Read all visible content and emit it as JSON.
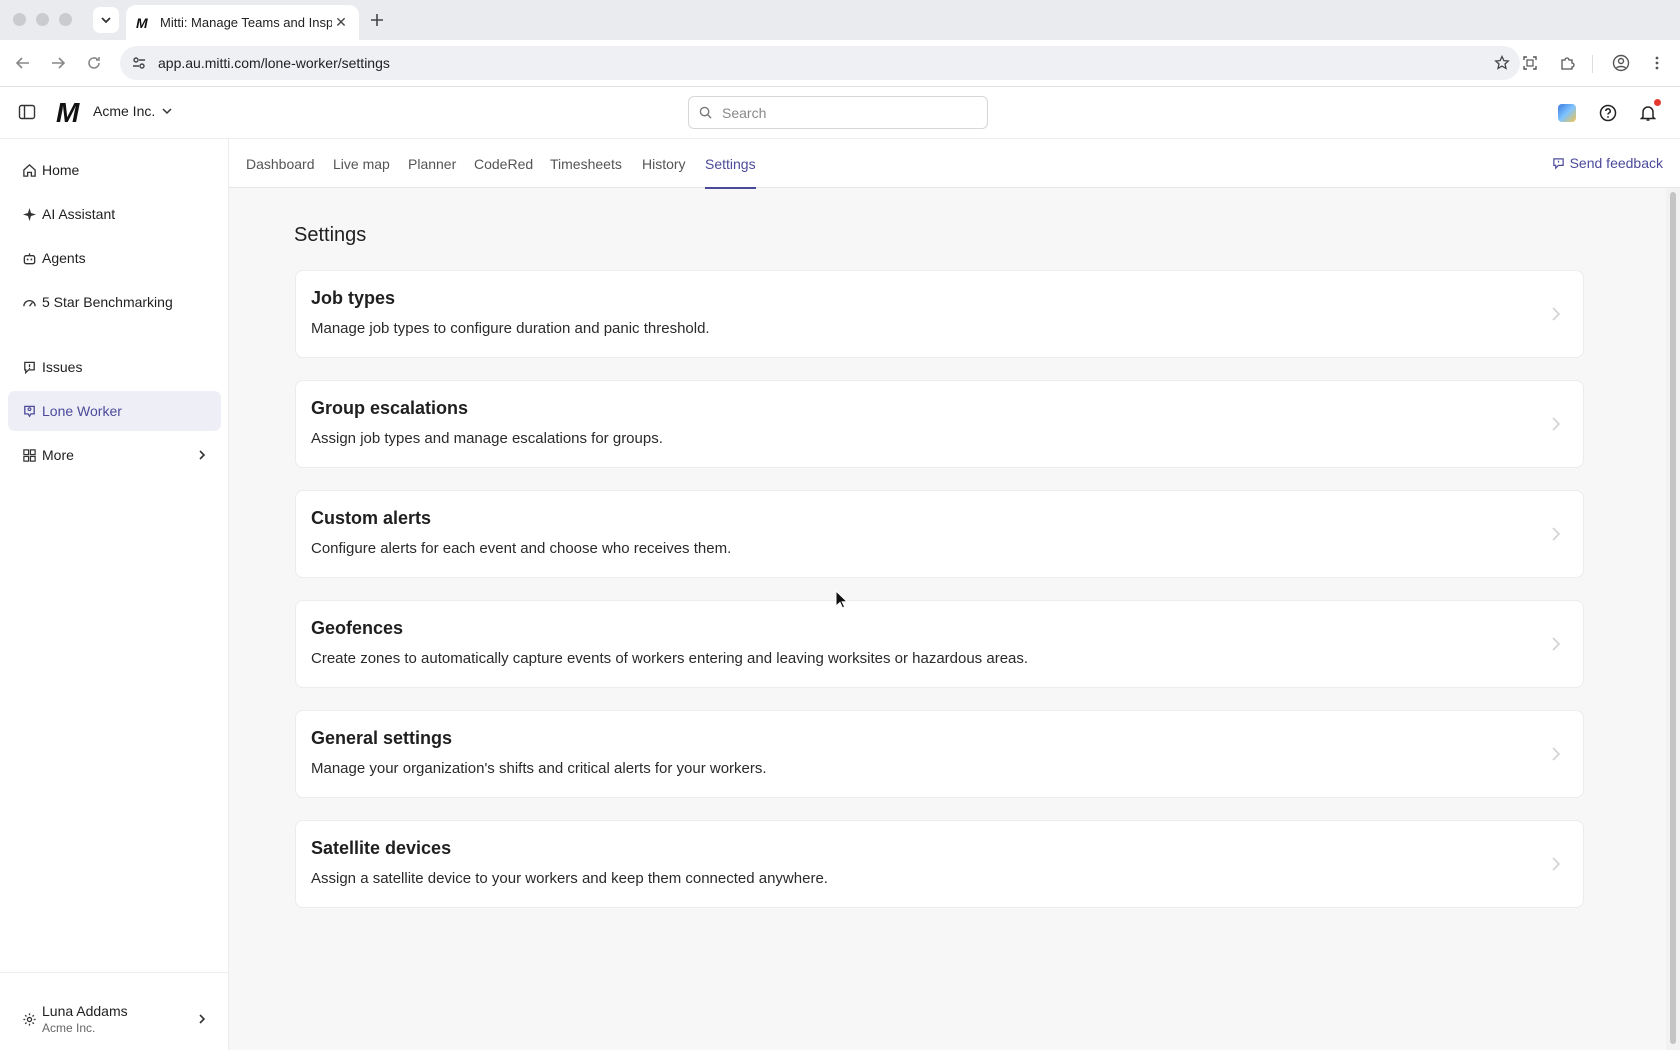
{
  "browser": {
    "tab_title": "Mitti: Manage Teams and Insp",
    "tab_favicon": "M",
    "url": "app.au.mitti.com/lone-worker/settings"
  },
  "header": {
    "logo_letter": "M",
    "org_name": "Acme Inc.",
    "search_placeholder": "Search"
  },
  "sidebar": {
    "items": [
      {
        "label": "Home",
        "icon": "home-icon"
      },
      {
        "label": "AI Assistant",
        "icon": "sparkle-icon"
      },
      {
        "label": "Agents",
        "icon": "robot-icon"
      },
      {
        "label": "5 Star Benchmarking",
        "icon": "gauge-icon"
      },
      {
        "label": "Issues",
        "icon": "alert-bubble-icon"
      },
      {
        "label": "Lone Worker",
        "icon": "person-pin-icon",
        "active": true
      },
      {
        "label": "More",
        "icon": "grid-icon"
      }
    ],
    "user": {
      "name": "Luna Addams",
      "org": "Acme Inc."
    }
  },
  "subnav": {
    "tabs": [
      "Dashboard",
      "Live map",
      "Planner",
      "CodeRed",
      "Timesheets",
      "History",
      "Settings"
    ],
    "active": "Settings",
    "feedback_label": "Send feedback"
  },
  "page": {
    "title": "Settings",
    "cards": [
      {
        "title": "Job types",
        "description": "Manage job types to configure duration and panic threshold."
      },
      {
        "title": "Group escalations",
        "description": "Assign job types and manage escalations for groups."
      },
      {
        "title": "Custom alerts",
        "description": "Configure alerts for each event and choose who receives them."
      },
      {
        "title": "Geofences",
        "description": "Create zones to automatically capture events of workers entering and leaving worksites or hazardous areas."
      },
      {
        "title": "General settings",
        "description": "Manage your organization's shifts and critical alerts for your workers."
      },
      {
        "title": "Satellite devices",
        "description": "Assign a satellite device to your workers and keep them connected anywhere."
      }
    ]
  },
  "colors": {
    "accent": "#4b4a9a",
    "active_bg": "#eeeef7",
    "notification": "#e5392f"
  }
}
